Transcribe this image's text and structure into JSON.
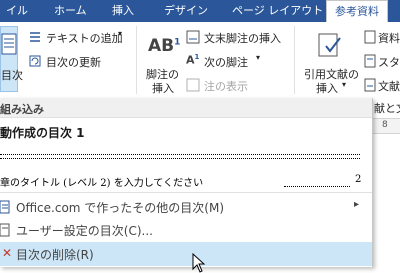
{
  "tabs": [
    {
      "label": "イル"
    },
    {
      "label": "ホーム"
    },
    {
      "label": "挿入"
    },
    {
      "label": "デザイン"
    },
    {
      "label": "ページ レイアウト"
    },
    {
      "label": "参考資料"
    }
  ],
  "ribbon": {
    "toc_label": "目次",
    "add_text": "テキストの追加",
    "update_toc": "目次の更新",
    "footnote_insert_line1": "脚注の",
    "footnote_insert_line2": "挿入",
    "endnote_insert": "文末脚注の挿入",
    "next_footnote": "次の脚注",
    "show_notes": "注の表示",
    "citation_line1": "引用文献の",
    "citation_line2": "挿入",
    "resource": "資料",
    "style": "スタ",
    "bib": "文献"
  },
  "document": {
    "text": "献と文",
    "ruler": "8"
  },
  "menu": {
    "section_header": "組み込み",
    "auto_toc_title": "動作成の目次 1",
    "toc_entry": "章のタイトル (レベル 2) を入力してください",
    "toc_page": "2",
    "more_toc": "Office.com で作ったその他の目次(M)",
    "custom_toc": "ユーザー設定の目次(C)...",
    "delete_toc": "目次の削除(R)"
  },
  "colors": {
    "tab_bar": "#2b579a",
    "hover": "#cde6f7",
    "delete_icon": "#c0392b",
    "accent": "#2b579a"
  }
}
